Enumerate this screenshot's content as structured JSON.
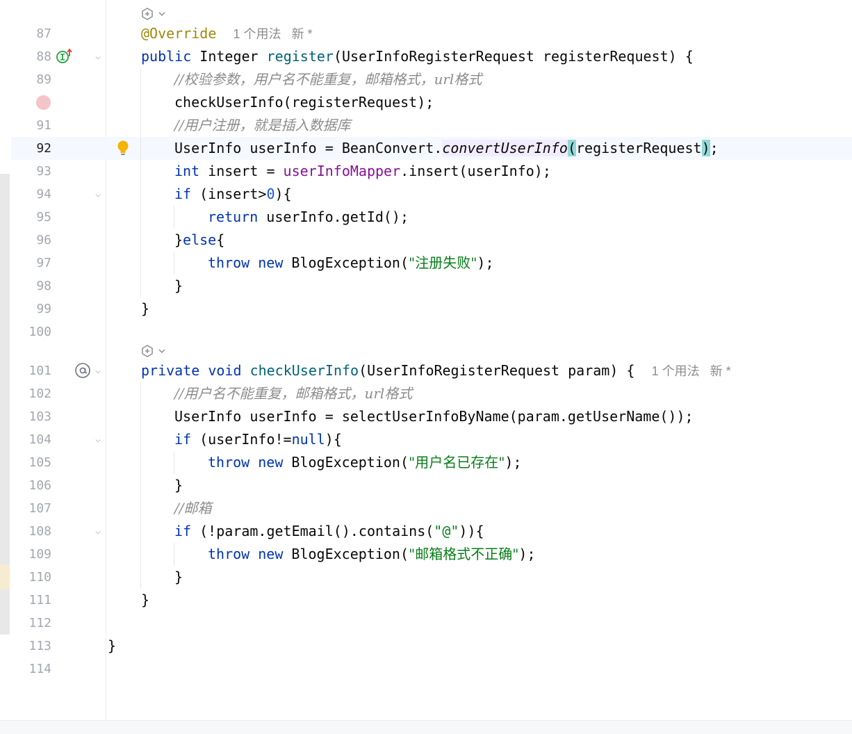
{
  "editor": {
    "lines": [
      {
        "n": "87",
        "caret": false
      },
      {
        "n": "88",
        "caret": false
      },
      {
        "n": "89",
        "caret": false
      },
      {
        "n": "",
        "caret": false
      },
      {
        "n": "91",
        "caret": false
      },
      {
        "n": "92",
        "caret": true
      },
      {
        "n": "93",
        "caret": false
      },
      {
        "n": "94",
        "caret": false
      },
      {
        "n": "95",
        "caret": false
      },
      {
        "n": "96",
        "caret": false
      },
      {
        "n": "97",
        "caret": false
      },
      {
        "n": "98",
        "caret": false
      },
      {
        "n": "99",
        "caret": false
      },
      {
        "n": "100",
        "caret": false
      },
      {
        "n": "101",
        "caret": false
      },
      {
        "n": "102",
        "caret": false
      },
      {
        "n": "103",
        "caret": false
      },
      {
        "n": "104",
        "caret": false
      },
      {
        "n": "105",
        "caret": false
      },
      {
        "n": "106",
        "caret": false
      },
      {
        "n": "107",
        "caret": false
      },
      {
        "n": "108",
        "caret": false
      },
      {
        "n": "109",
        "caret": false
      },
      {
        "n": "110",
        "caret": false
      },
      {
        "n": "111",
        "caret": false
      },
      {
        "n": "112",
        "caret": false
      },
      {
        "n": "113",
        "caret": false
      },
      {
        "n": "114",
        "caret": false
      }
    ],
    "code": {
      "l87_ann": "@Override",
      "l87_hint": "1 个用法   新 *",
      "l88_kw": "public",
      "l88_type": "Integer",
      "l88_fn": "register",
      "l88_rest": "(UserInfoRegisterRequest registerRequest) {",
      "l89_cmt": "//校验参数，用户名不能重复，邮箱格式，url格式",
      "l90": "checkUserInfo(registerRequest);",
      "l91_cmt": "//用户注册，就是插入数据库",
      "l92_a": "UserInfo userInfo = BeanConvert.",
      "l92_fn": "convertUserInfo",
      "l92_p1": "(",
      "l92_arg": "registerRequest",
      "l92_p2": ")",
      "l92_end": ";",
      "l93_kw": "int",
      "l93_a": " insert = ",
      "l93_fld": "userInfoMapper",
      "l93_b": ".insert(userInfo);",
      "l94_kw": "if",
      "l94_a": " (insert>",
      "l94_num": "0",
      "l94_b": "){",
      "l95_kw": "return",
      "l95_a": " userInfo.getId();",
      "l96_a": "}",
      "l96_kw": "else",
      "l96_b": "{",
      "l97_kw1": "throw",
      "l97_kw2": "new",
      "l97_a": " BlogException(",
      "l97_str": "\"注册失败\"",
      "l97_b": ");",
      "l98": "}",
      "l99": "}",
      "l101_kw1": "private",
      "l101_kw2": "void",
      "l101_fn": "checkUserInfo",
      "l101_rest": "(UserInfoRegisterRequest param) {",
      "l101_hint": "1 个用法   新 *",
      "l102_cmt": "//用户名不能重复，邮箱格式，url格式",
      "l103": "UserInfo userInfo = selectUserInfoByName(param.getUserName());",
      "l104_kw": "if",
      "l104_a": " (userInfo!=",
      "l104_kw2": "null",
      "l104_b": "){",
      "l105_kw1": "throw",
      "l105_kw2": "new",
      "l105_a": " BlogException(",
      "l105_str": "\"用户名已存在\"",
      "l105_b": ");",
      "l106": "}",
      "l107_cmt": "//邮箱",
      "l108_kw": "if",
      "l108_a": " (!param.getEmail().contains(",
      "l108_str": "\"@\"",
      "l108_b": ")){",
      "l109_kw1": "throw",
      "l109_kw2": "new",
      "l109_a": " BlogException(",
      "l109_str": "\"邮箱格式不正确\"",
      "l109_b": ");",
      "l110": "}",
      "l111": "}",
      "l113": "}"
    },
    "icons": [
      "ai-assist-icon",
      "implements-icon",
      "breakpoint-icon",
      "intention-bulb-icon",
      "annotation-icon",
      "fold-arrow-icon"
    ]
  }
}
